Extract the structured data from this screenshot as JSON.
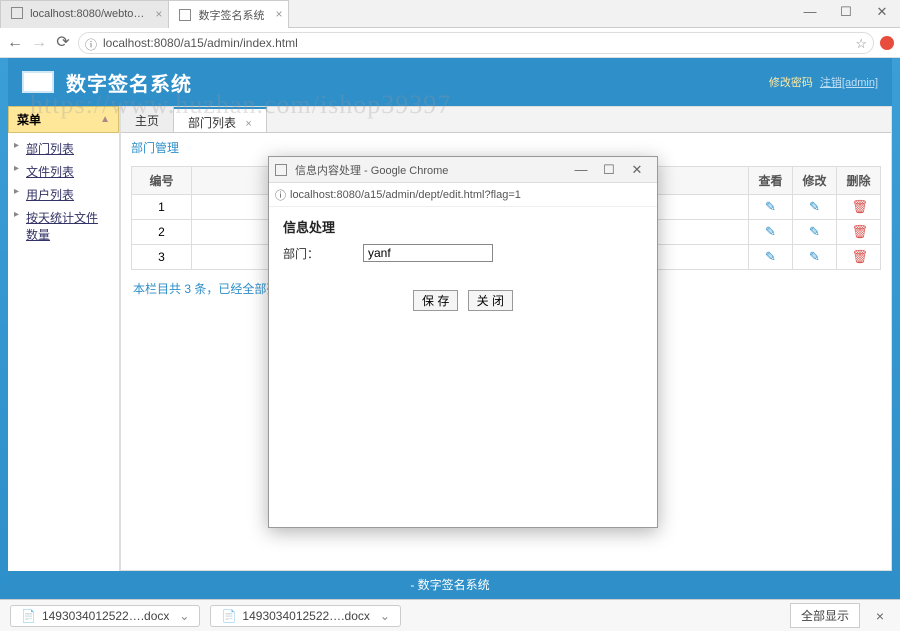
{
  "browser": {
    "tabs": [
      {
        "title": "localhost:8080/webto…"
      },
      {
        "title": "数字签名系统"
      }
    ],
    "url": "localhost:8080/a15/admin/index.html"
  },
  "app": {
    "title": "数字签名系统",
    "header_links": {
      "prefix": "修改密码",
      "logout": "注销[admin]"
    },
    "footer": "- 数字签名系统"
  },
  "sidebar": {
    "accordion_title": "菜单",
    "items": [
      {
        "label": "部门列表"
      },
      {
        "label": "文件列表"
      },
      {
        "label": "用户列表"
      },
      {
        "label": "按天统计文件数量"
      }
    ]
  },
  "main_tabs": [
    {
      "label": "主页",
      "active": false,
      "closable": false
    },
    {
      "label": "部门列表",
      "active": true,
      "closable": true
    }
  ],
  "breadcrumb": "部门管理",
  "table": {
    "headers": {
      "id": "编号",
      "view": "查看",
      "edit": "修改",
      "delete": "删除"
    },
    "rows": [
      {
        "id": "1"
      },
      {
        "id": "2"
      },
      {
        "id": "3"
      }
    ],
    "footer": "本栏目共 3 条，已经全部列出"
  },
  "popup": {
    "window_title": "信息内容处理 - Google Chrome",
    "url": "localhost:8080/a15/admin/dept/edit.html?flag=1",
    "heading": "信息处理",
    "field_label": "部门：",
    "field_value": "yanf",
    "btn_save": "保 存",
    "btn_close": "关 闭"
  },
  "downloads": {
    "file1": "1493034012522….docx",
    "file2": "1493034012522….docx",
    "show_all": "全部显示"
  },
  "watermark": "https://www.huzhan.com/ishop39397"
}
